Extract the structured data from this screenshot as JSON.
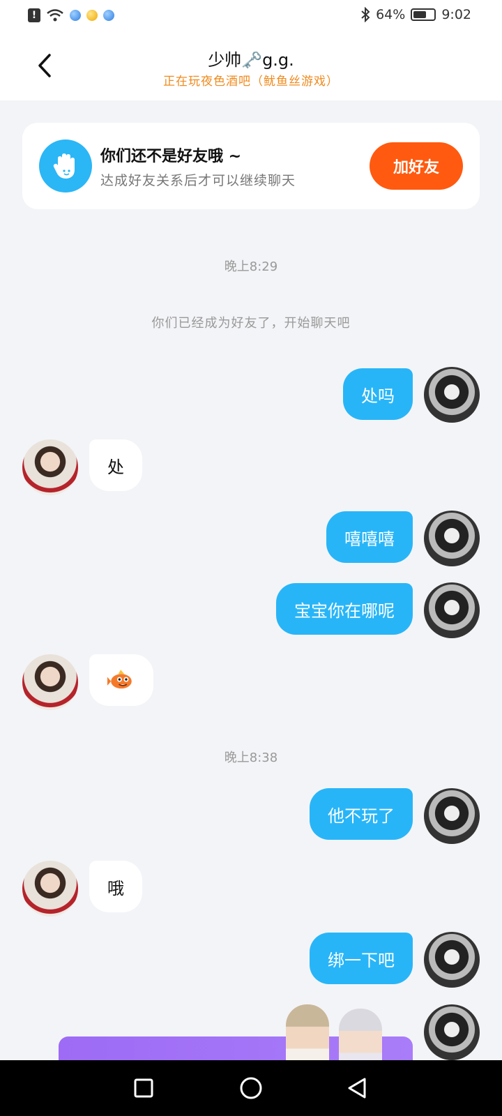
{
  "status": {
    "battery": "64%",
    "time": "9:02"
  },
  "header": {
    "title": "少帅🗝️g.g.",
    "subtitle": "正在玩夜色酒吧（鱿鱼丝游戏）"
  },
  "friend_card": {
    "title": "你们还不是好友哦 ~",
    "desc": "达成好友关系后才可以继续聊天",
    "button": "加好友"
  },
  "chat": {
    "time1": "晚上8:29",
    "system1": "你们已经成为好友了，开始聊天吧",
    "time2": "晚上8:38",
    "messages": [
      {
        "side": "me",
        "text": "处吗"
      },
      {
        "side": "them",
        "text": "处"
      },
      {
        "side": "me",
        "text": "嘻嘻嘻"
      },
      {
        "side": "me",
        "text": "宝宝你在哪呢"
      },
      {
        "side": "them",
        "text": "",
        "sticker": "fish-sticker"
      },
      {
        "side": "me",
        "text": "他不玩了"
      },
      {
        "side": "them",
        "text": "哦"
      },
      {
        "side": "me",
        "text": "绑一下吧"
      }
    ]
  },
  "colors": {
    "accent_blue": "#28b5f8",
    "add_orange": "#ff5a0f",
    "subtitle_orange": "#f08a1d",
    "promo_purple": "#9d6bf5"
  }
}
